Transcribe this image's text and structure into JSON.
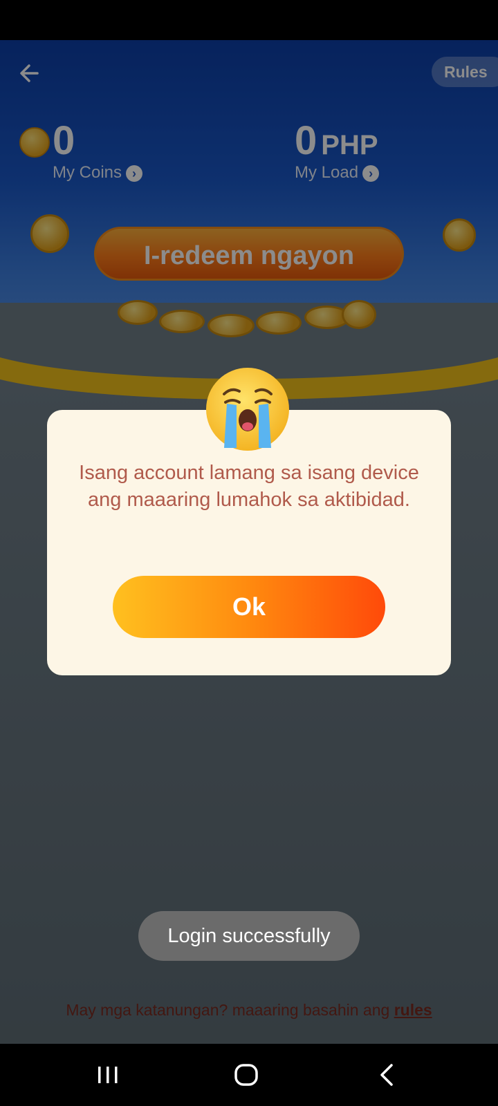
{
  "header": {
    "rules_label": "Rules"
  },
  "stats": {
    "coins_value": "0",
    "coins_label": "My Coins",
    "load_value": "0",
    "load_unit": "PHP",
    "load_label": "My Load"
  },
  "redeem": {
    "label": "I-redeem ngayon"
  },
  "modal": {
    "message": "Isang account lamang sa isang device ang maaaring lumahok sa aktibidad.",
    "ok_label": "Ok"
  },
  "toast": {
    "message": "Login successfully"
  },
  "footer": {
    "question": "May mga katanungan? maaaring basahin ang",
    "rules_link": "rules"
  },
  "colors": {
    "accent_orange": "#ff7d1a",
    "hero_blue": "#1a58c8",
    "modal_bg": "#fdf6e6",
    "modal_text": "#b05a4b"
  }
}
